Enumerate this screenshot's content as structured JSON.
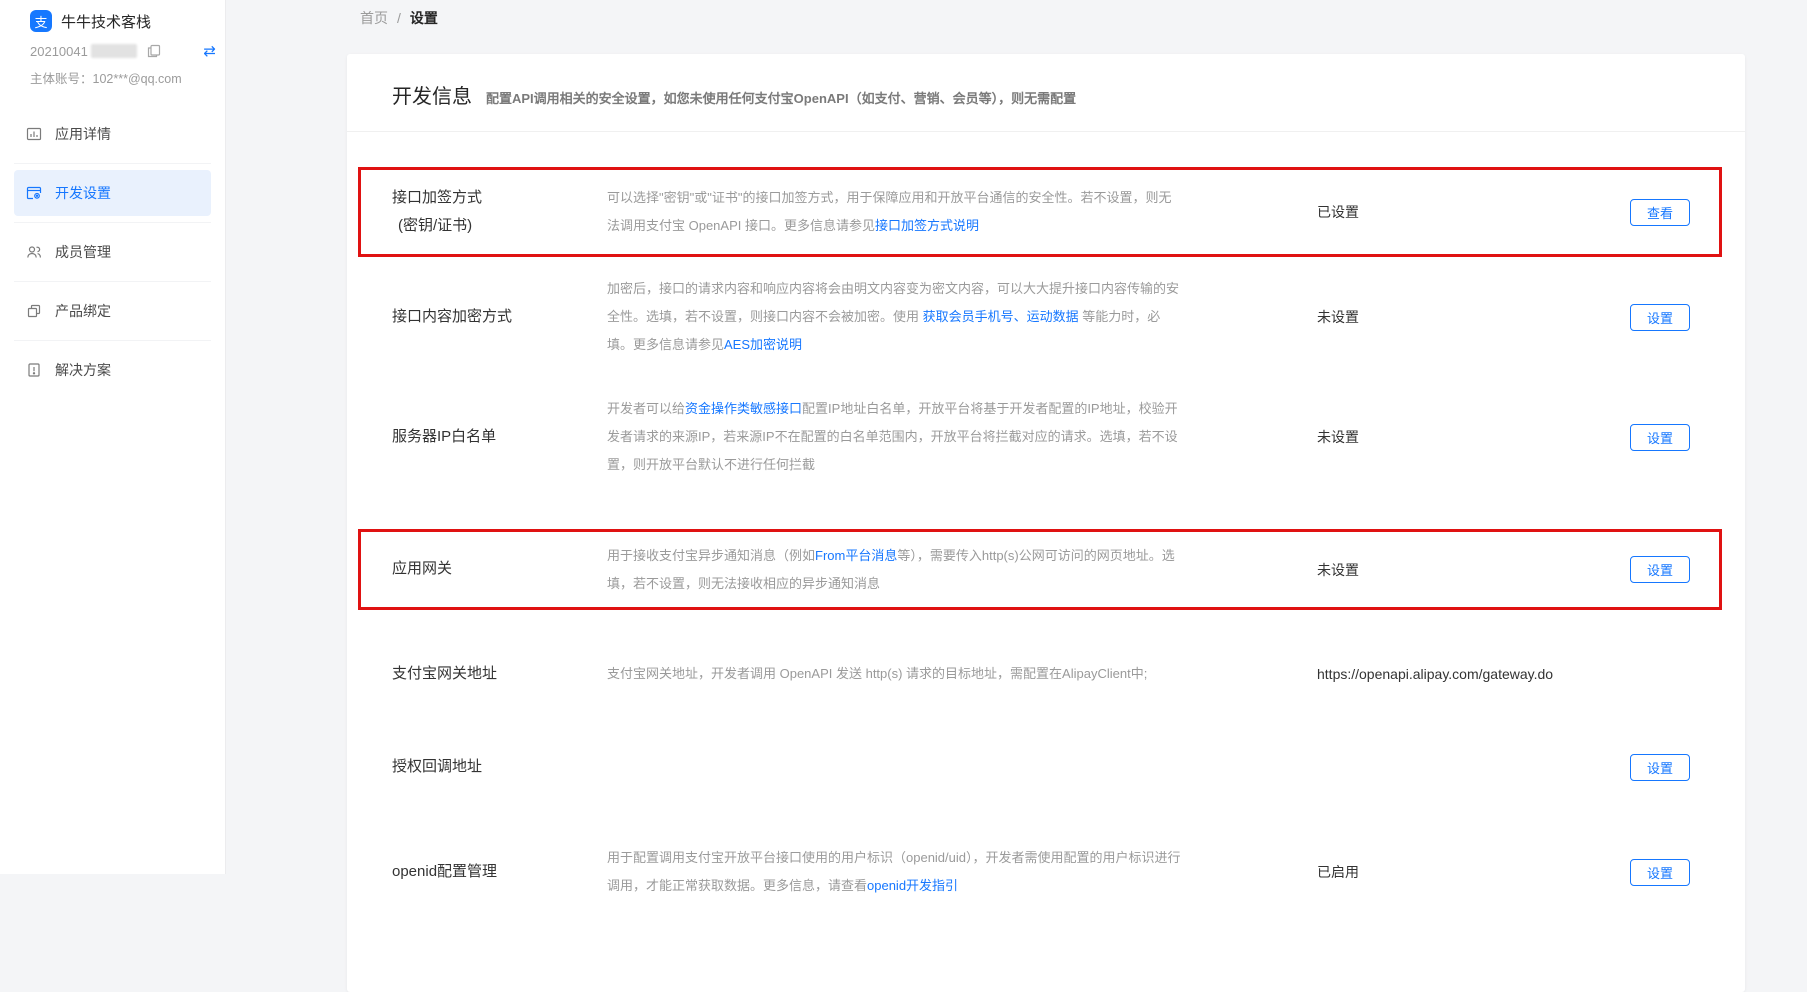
{
  "colors": {
    "accent": "#1677ff",
    "annotation_red": "#e01212",
    "active_item_bg": "#e9f1fd"
  },
  "sidebar": {
    "logo_glyph": "支",
    "app_name": "牛牛技术客栈",
    "app_id_visible": "20210041",
    "swap_icon_glyph": "⇄",
    "account": "主体账号：102***@qq.com",
    "items": [
      {
        "label": "应用详情"
      },
      {
        "label": "开发设置"
      },
      {
        "label": "成员管理"
      },
      {
        "label": "产品绑定"
      },
      {
        "label": "解决方案"
      }
    ]
  },
  "breadcrumb": {
    "home": "首页",
    "separator": "/",
    "current": "设置"
  },
  "panel": {
    "title": "开发信息",
    "subtitle": "配置API调用相关的安全设置，如您未使用任何支付宝OpenAPI（如支付、营销、会员等），则无需配置"
  },
  "rows": [
    {
      "label": "接口加签方式",
      "label2": "(密钥/证书)",
      "desc": [
        {
          "text": "可以选择\"密钥\"或\"证书\"的接口加签方式，用于保障应用和开放平台通信的安全性。若不设置，则无法调用支付宝 OpenAPI 接口。更多信息请参见"
        },
        {
          "text": "接口加签方式说明",
          "link": true
        }
      ],
      "status": "已设置",
      "button": "查看",
      "annotated": true
    },
    {
      "label": "接口内容加密方式",
      "desc": [
        {
          "text": "加密后，接口的请求内容和响应内容将会由明文内容变为密文内容，可以大大提升接口内容传输的安全性。选填，若不设置，则接口内容不会被加密。使用 "
        },
        {
          "text": "获取会员手机号、运动数据",
          "link": true
        },
        {
          "text": " 等能力时，必填。更多信息请参见"
        },
        {
          "text": "AES加密说明",
          "link": true
        }
      ],
      "status": "未设置",
      "button": "设置"
    },
    {
      "label": "服务器IP白名单",
      "desc": [
        {
          "text": "开发者可以给"
        },
        {
          "text": "资金操作类敏感接口",
          "link": true
        },
        {
          "text": "配置IP地址白名单，开放平台将基于开发者配置的IP地址，校验开发者请求的来源IP，若来源IP不在配置的白名单范围内，开放平台将拦截对应的请求。选填，若不设置，则开放平台默认不进行任何拦截"
        }
      ],
      "status": "未设置",
      "button": "设置"
    },
    {
      "label": "应用网关",
      "desc": [
        {
          "text": "用于接收支付宝异步通知消息（例如"
        },
        {
          "text": "From平台消息",
          "link": true
        },
        {
          "text": "等），需要传入http(s)公网可访问的网页地址。选填，若不设置，则无法接收相应的异步通知消息"
        }
      ],
      "status": "未设置",
      "button": "设置",
      "annotated": true
    },
    {
      "label": "支付宝网关地址",
      "desc": [
        {
          "text": "支付宝网关地址，开发者调用 OpenAPI 发送 http(s) 请求的目标地址，需配置在AlipayClient中;"
        }
      ],
      "value": "https://openapi.alipay.com/gateway.do"
    },
    {
      "label": "授权回调地址",
      "desc": [],
      "button": "设置"
    },
    {
      "label": "openid配置管理",
      "desc": [
        {
          "text": "用于配置调用支付宝开放平台接口使用的用户标识（openid/uid），开发者需使用配置的用户标识进行调用，才能正常获取数据。更多信息，请查看"
        },
        {
          "text": "openid开发指引",
          "link": true
        }
      ],
      "status": "已启用",
      "button": "设置"
    }
  ]
}
